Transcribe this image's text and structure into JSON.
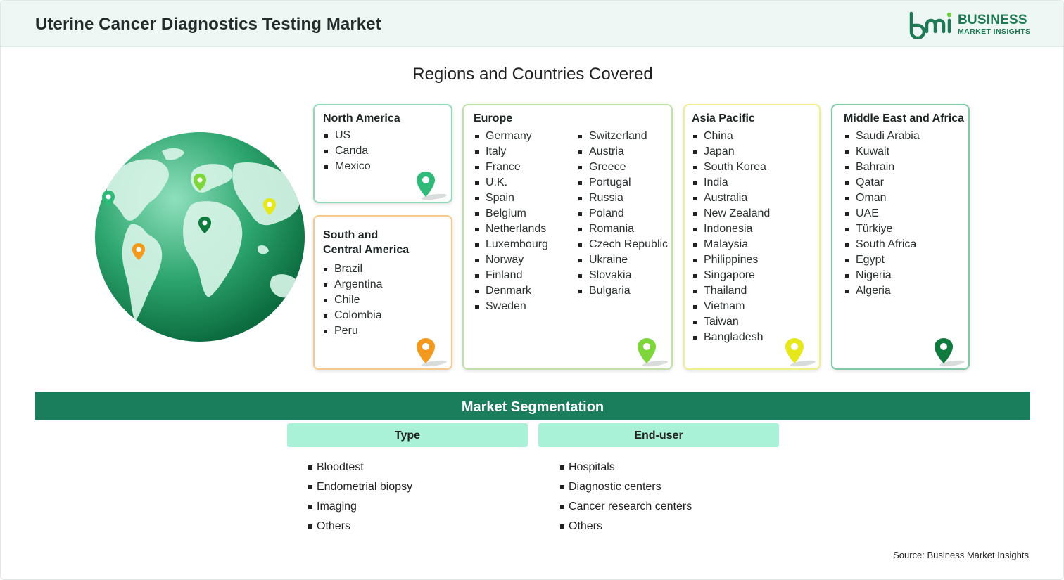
{
  "header": {
    "title": "Uterine Cancer Diagnostics Testing Market",
    "logo_line1": "BUSINESS",
    "logo_line2": "MARKET INSIGHTS"
  },
  "regions_title": "Regions and Countries Covered",
  "regions": {
    "north_america": {
      "title": "North America",
      "countries": [
        "US",
        "Canda",
        "Mexico"
      ],
      "accent": "#8fd9b9",
      "pin_color": "#2fba7a"
    },
    "south_america": {
      "title_line1": "South and",
      "title_line2": "Central America",
      "countries": [
        "Brazil",
        "Argentina",
        "Chile",
        "Colombia",
        "Peru"
      ],
      "accent": "#f7c98a",
      "pin_color": "#f39a1e"
    },
    "europe": {
      "title": "Europe",
      "countries_col1": [
        "Germany",
        "Italy",
        "France",
        "U.K.",
        "Spain",
        "Belgium",
        "Netherlands",
        "Luxembourg",
        "Norway",
        "Finland",
        "Denmark",
        "Sweden"
      ],
      "countries_col2": [
        "Switzerland",
        "Austria",
        "Greece",
        "Portugal",
        "Russia",
        "Poland",
        "Romania",
        "Czech Republic",
        "Ukraine",
        "Slovakia",
        "Bulgaria"
      ],
      "accent": "#bfe3a6",
      "pin_color": "#7dd63a"
    },
    "asia_pacific": {
      "title": "Asia Pacific",
      "countries": [
        "China",
        "Japan",
        "South Korea",
        "India",
        "Australia",
        "New Zealand",
        "Indonesia",
        "Malaysia",
        "Philippines",
        "Singapore",
        "Thailand",
        "Vietnam",
        "Taiwan",
        "Bangladesh"
      ],
      "accent": "#f1ee8e",
      "pin_color": "#e6e81c"
    },
    "mea": {
      "title": "Middle East and Africa",
      "countries": [
        "Saudi Arabia",
        "Kuwait",
        "Bahrain",
        "Qatar",
        "Oman",
        "UAE",
        "Türkiye",
        "South Africa",
        "Egypt",
        "Nigeria",
        "Algeria"
      ],
      "accent": "#7fc9a5",
      "pin_color": "#0f7a3e"
    }
  },
  "segmentation": {
    "title": "Market Segmentation",
    "type": {
      "label": "Type",
      "items": [
        "Bloodtest",
        "Endometrial biopsy",
        "Imaging",
        "Others"
      ]
    },
    "end_user": {
      "label": "End-user",
      "items": [
        "Hospitals",
        "Diagnostic centers",
        "Cancer research centers",
        "Others"
      ]
    }
  },
  "source": "Source: Business Market Insights",
  "colors": {
    "brand": "#1e7a55",
    "segmentation_bar": "#1a7d5c",
    "segment_header": "#a9f2d7"
  }
}
